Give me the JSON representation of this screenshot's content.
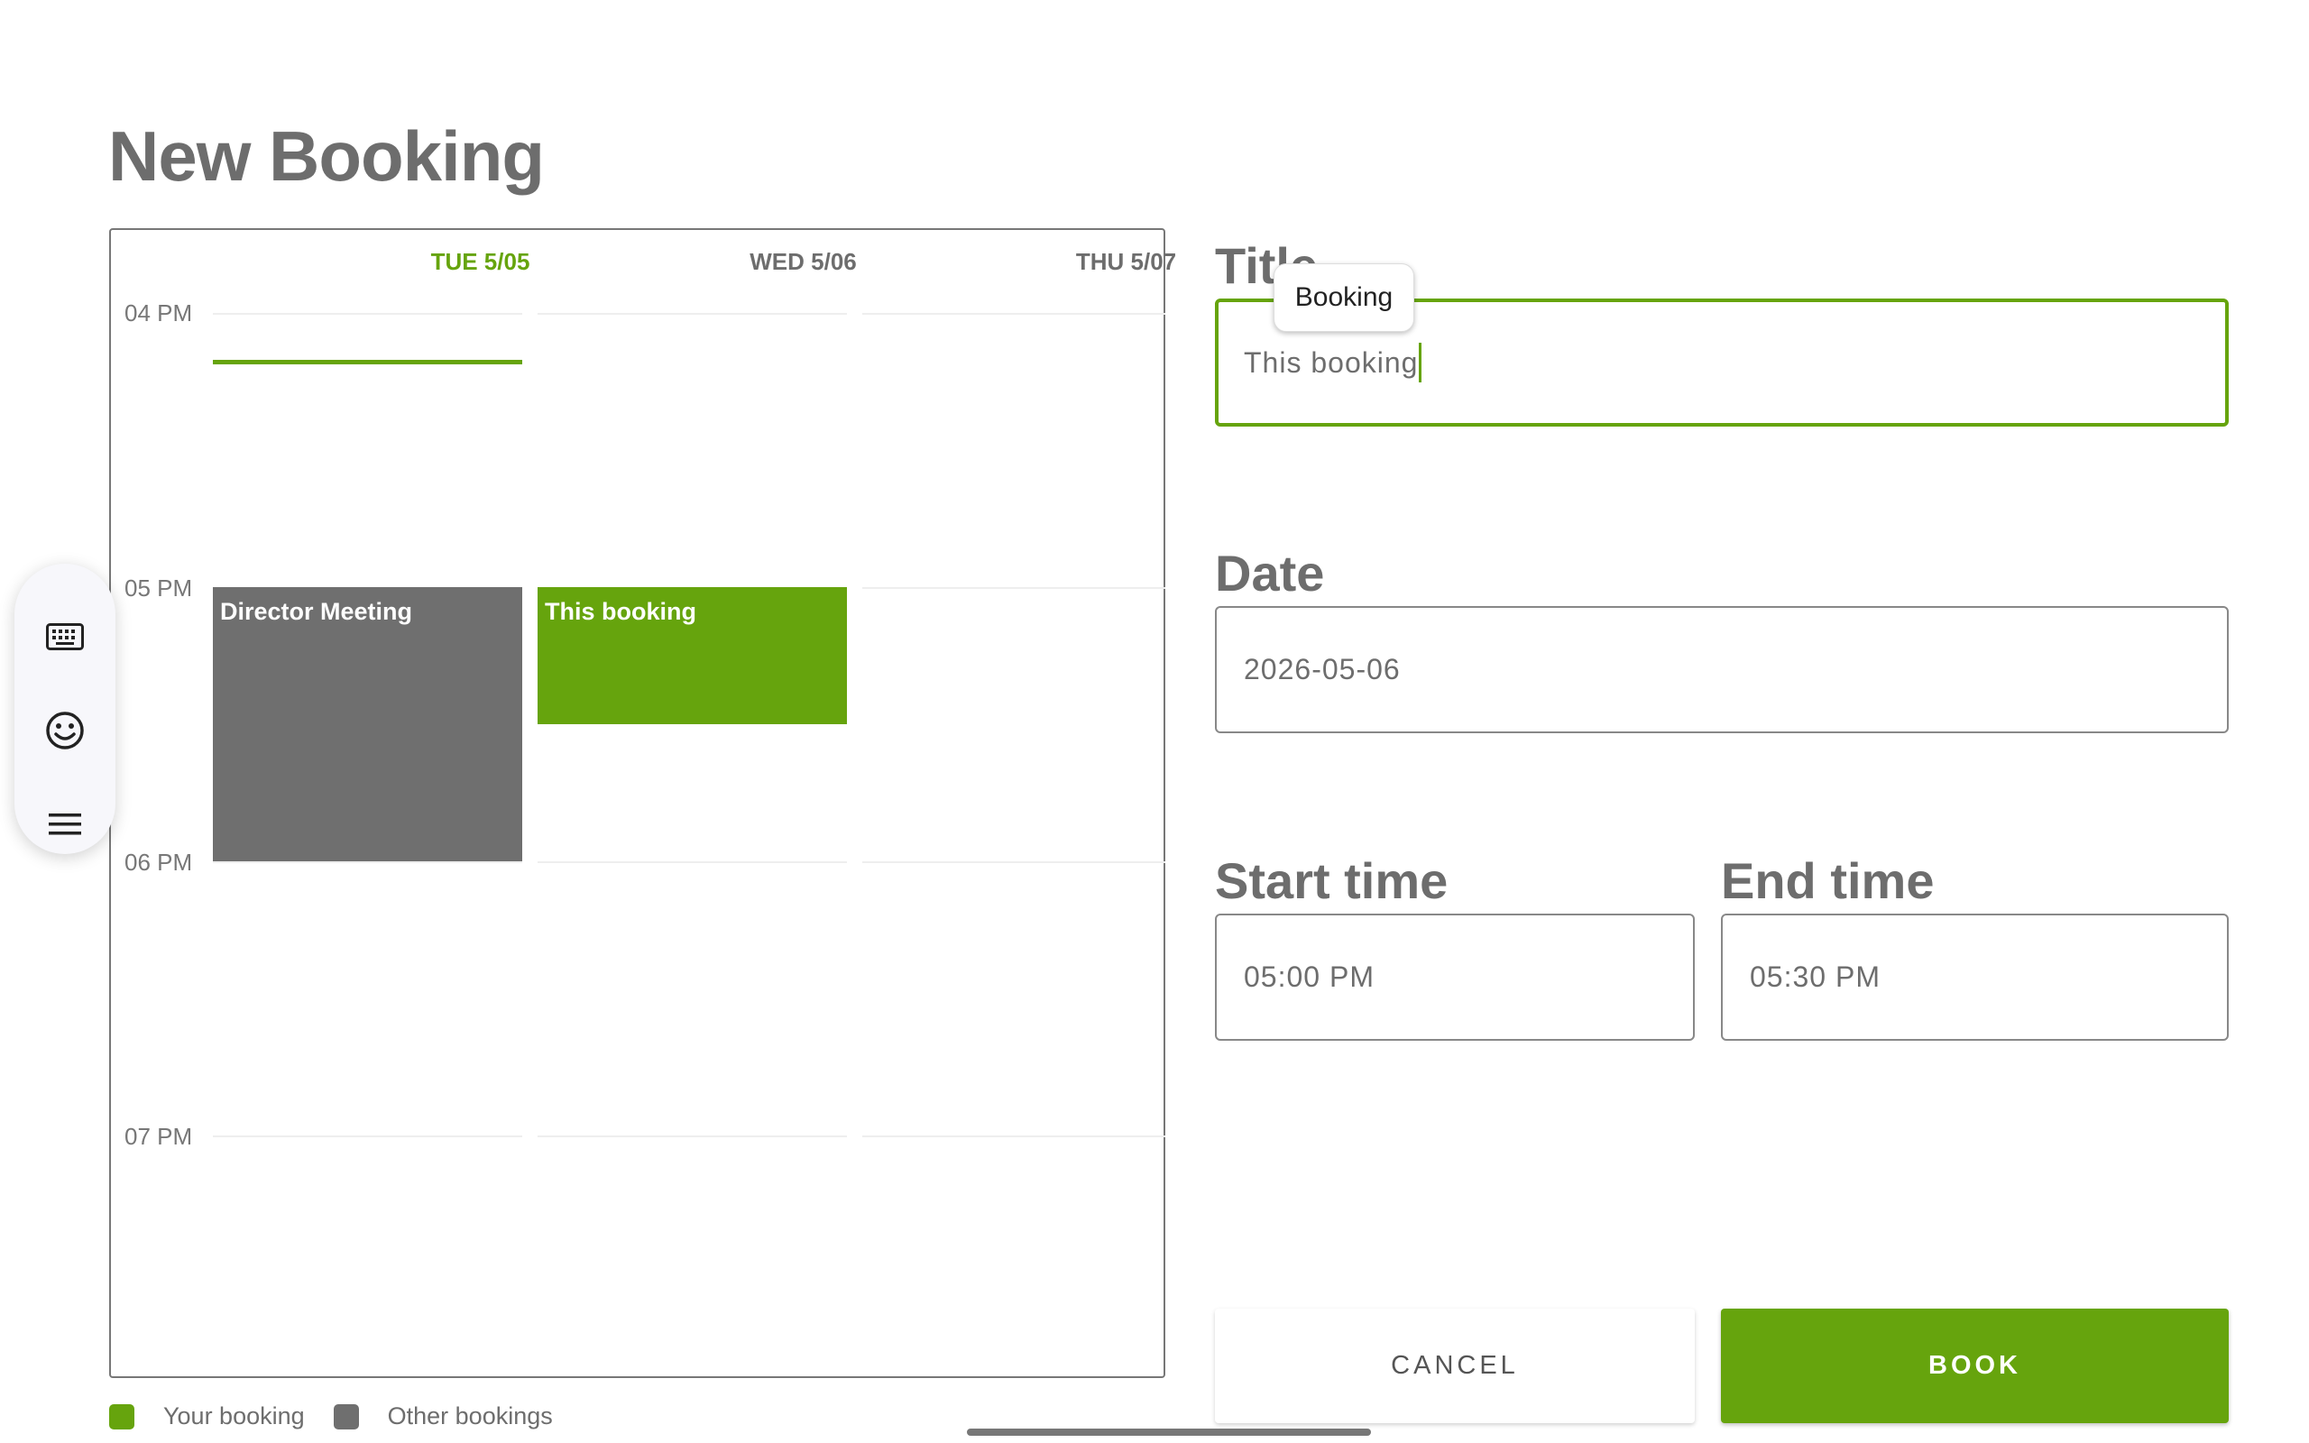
{
  "page": {
    "title": "New Booking"
  },
  "calendar": {
    "columns": [
      {
        "label": "TUE 5/05",
        "is_today": true
      },
      {
        "label": "WED 5/06",
        "is_today": false
      },
      {
        "label": "THU 5/07",
        "is_today": false
      }
    ],
    "time_labels": [
      "04 PM",
      "05 PM",
      "06 PM",
      "07 PM"
    ],
    "events": [
      {
        "title": "Director Meeting",
        "kind": "other",
        "day": "TUE 5/05",
        "start": "05 PM",
        "end": "06 PM"
      },
      {
        "title": "This booking",
        "kind": "mine",
        "day": "WED 5/06",
        "start": "05:00 PM",
        "end": "05:30 PM"
      }
    ]
  },
  "legend": {
    "yours": {
      "label": "Your booking",
      "color": "#66a40d"
    },
    "others": {
      "label": "Other bookings",
      "color": "#6f6f6f"
    }
  },
  "form": {
    "title_label": "Title",
    "title_value": "This booking",
    "title_suggestion": "Booking",
    "date_label": "Date",
    "date_value": "2026-05-06",
    "start_label": "Start time",
    "start_value": "05:00 PM",
    "end_label": "End time",
    "end_value": "05:30 PM"
  },
  "buttons": {
    "cancel": "CANCEL",
    "book": "BOOK"
  },
  "toolbar": {
    "icons": [
      "keyboard-icon",
      "emoji-icon",
      "menu-icon"
    ]
  },
  "colors": {
    "accent": "#66a40d",
    "other_event": "#6f6f6f",
    "text": "#6d6d6d"
  }
}
